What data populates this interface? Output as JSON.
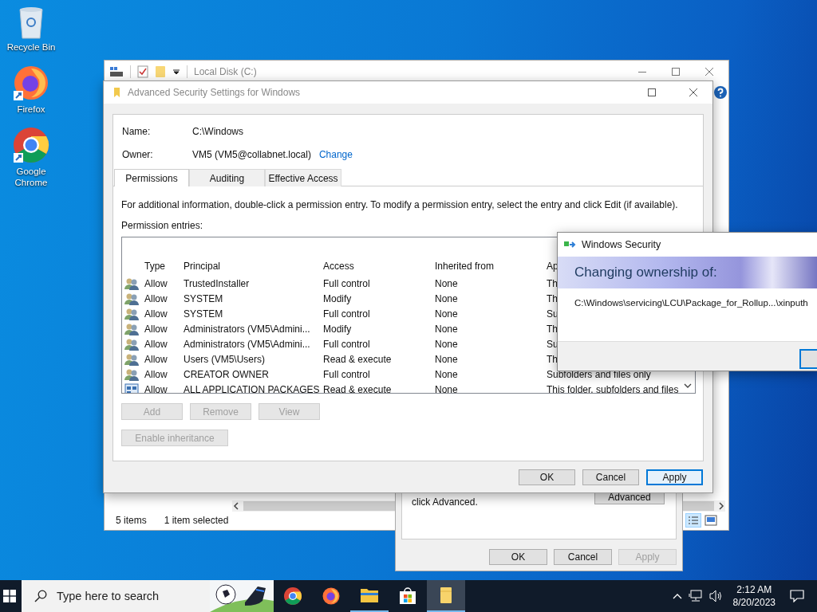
{
  "desktop_icons": [
    {
      "label": "Recycle Bin",
      "kind": "recycle"
    },
    {
      "label": "Firefox",
      "kind": "firefox"
    },
    {
      "label": "Google Chrome",
      "kind": "chrome"
    }
  ],
  "explorer": {
    "title": "Local Disk (C:)",
    "status_items": "5 items",
    "status_selected": "1 item selected"
  },
  "properties": {
    "note": "click Advanced.",
    "advanced_button": "Advanced",
    "buttons": [
      {
        "label": "OK",
        "disabled": false
      },
      {
        "label": "Cancel",
        "disabled": false
      },
      {
        "label": "Apply",
        "disabled": true
      }
    ]
  },
  "advanced": {
    "title": "Advanced Security Settings for Windows",
    "name_label": "Name:",
    "name": "C:\\Windows",
    "owner_label": "Owner:",
    "owner": "VM5 (VM5@collabnet.local)",
    "change_link": "Change",
    "tabs": [
      {
        "label": "Permissions",
        "selected": true
      },
      {
        "label": "Auditing",
        "selected": false
      },
      {
        "label": "Effective Access",
        "selected": false
      }
    ],
    "info": "For additional information, double-click a permission entry. To modify a permission entry, select the entry and click Edit (if available).",
    "entries_label": "Permission entries:",
    "columns": [
      "Type",
      "Principal",
      "Access",
      "Inherited from",
      "Ap"
    ],
    "rows": [
      {
        "kind": "group",
        "cells": [
          "Allow",
          "TrustedInstaller",
          "Full control",
          "None",
          "Th"
        ]
      },
      {
        "kind": "group",
        "cells": [
          "Allow",
          "SYSTEM",
          "Modify",
          "None",
          "Th"
        ]
      },
      {
        "kind": "group",
        "cells": [
          "Allow",
          "SYSTEM",
          "Full control",
          "None",
          "Su"
        ]
      },
      {
        "kind": "group",
        "cells": [
          "Allow",
          "Administrators (VM5\\Admini...",
          "Modify",
          "None",
          "Th"
        ]
      },
      {
        "kind": "group",
        "cells": [
          "Allow",
          "Administrators (VM5\\Admini...",
          "Full control",
          "None",
          "Su"
        ]
      },
      {
        "kind": "group",
        "cells": [
          "Allow",
          "Users (VM5\\Users)",
          "Read & execute",
          "None",
          "Th"
        ]
      },
      {
        "kind": "group",
        "cells": [
          "Allow",
          "CREATOR OWNER",
          "Full control",
          "None",
          "Subfolders and files only"
        ]
      },
      {
        "kind": "package",
        "cells": [
          "Allow",
          "ALL APPLICATION PACKAGES",
          "Read & execute",
          "None",
          "This folder, subfolders and files"
        ]
      }
    ],
    "entry_buttons": [
      {
        "label": "Add",
        "disabled": true
      },
      {
        "label": "Remove",
        "disabled": true
      },
      {
        "label": "View",
        "disabled": true
      }
    ],
    "inheritance_button": {
      "label": "Enable inheritance",
      "disabled": true
    },
    "buttons": [
      {
        "label": "OK",
        "default": false
      },
      {
        "label": "Cancel",
        "default": false
      },
      {
        "label": "Apply",
        "default": true
      }
    ]
  },
  "security_dialog": {
    "title": "Windows Security",
    "heading": "Changing ownership of:",
    "path": "C:\\Windows\\servicing\\LCU\\Package_for_Rollup...\\xinputh"
  },
  "taskbar": {
    "search_placeholder": "Type here to search",
    "apps": [
      {
        "kind": "chrome",
        "running": false,
        "selected": false
      },
      {
        "kind": "firefox",
        "running": false,
        "selected": false
      },
      {
        "kind": "explorer",
        "running": true,
        "selected": false
      },
      {
        "kind": "store",
        "running": false,
        "selected": false
      },
      {
        "kind": "folder",
        "running": true,
        "selected": true
      }
    ],
    "time": "2:12 AM",
    "date": "8/20/2023"
  }
}
